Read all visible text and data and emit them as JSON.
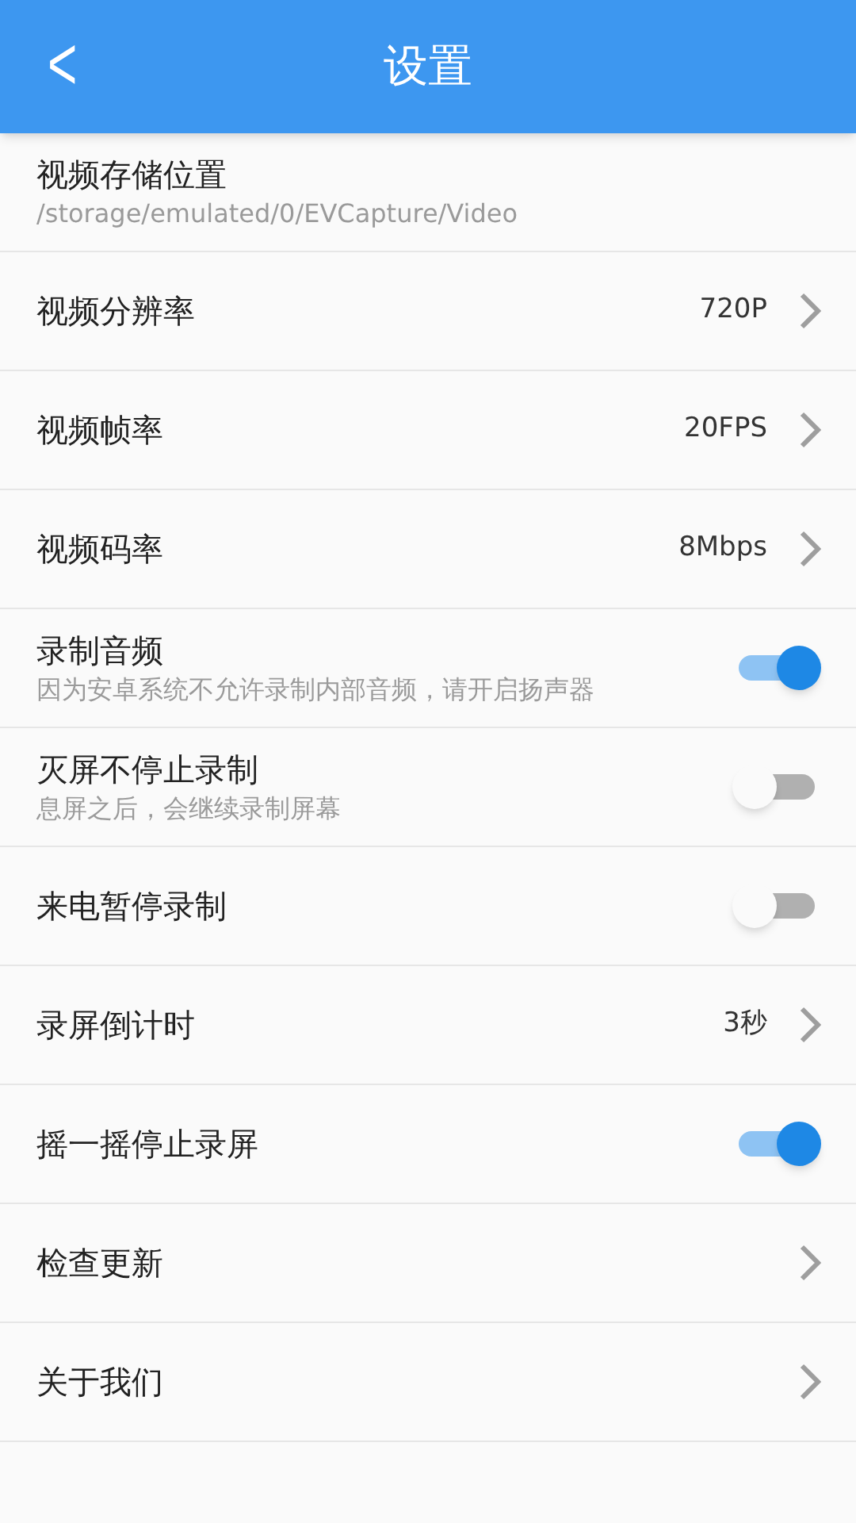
{
  "header": {
    "back": "<",
    "title": "设置"
  },
  "settings": [
    {
      "kind": "path",
      "title": "视频存储位置",
      "subtitle": "/storage/emulated/0/EVCapture/Video"
    },
    {
      "kind": "value",
      "title": "视频分辨率",
      "value": "720P"
    },
    {
      "kind": "value",
      "title": "视频帧率",
      "value": "20FPS"
    },
    {
      "kind": "value",
      "title": "视频码率",
      "value": "8Mbps"
    },
    {
      "kind": "toggle",
      "title": "录制音频",
      "subtitle": "因为安卓系统不允许录制内部音频，请开启扬声器",
      "on": true
    },
    {
      "kind": "toggle",
      "title": "灭屏不停止录制",
      "subtitle": "息屏之后，会继续录制屏幕",
      "on": false
    },
    {
      "kind": "toggle",
      "title": "来电暂停录制",
      "on": false
    },
    {
      "kind": "value",
      "title": "录屏倒计时",
      "value": "3秒"
    },
    {
      "kind": "toggle",
      "title": "摇一摇停止录屏",
      "on": true
    },
    {
      "kind": "link",
      "title": "检查更新"
    },
    {
      "kind": "link",
      "title": "关于我们"
    }
  ]
}
